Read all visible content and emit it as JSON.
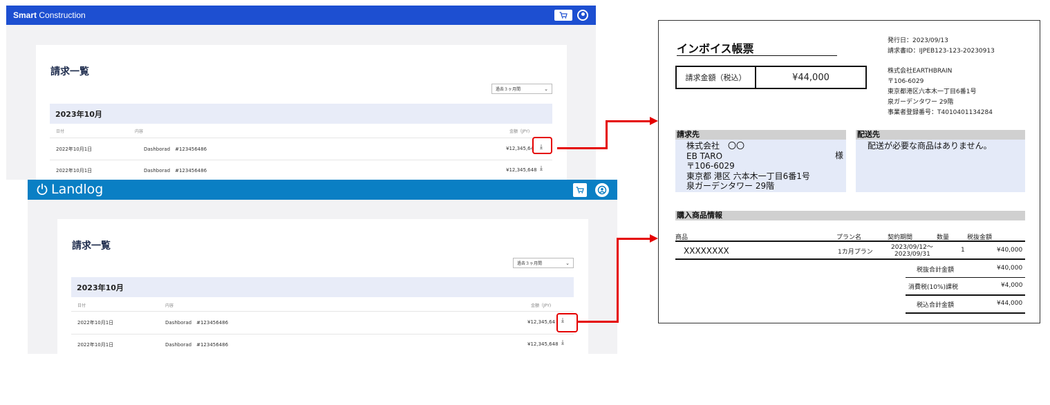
{
  "smart_construction": {
    "brand_bold": "Smart",
    "brand_rest": " Construction",
    "page_title": "請求一覧",
    "period_select": "過去３ヶ月間",
    "month_header": "2023年10月",
    "columns": {
      "date": "日付",
      "content": "内容",
      "amount": "金額（JPY)"
    },
    "rows": [
      {
        "date": "2022年10月1日",
        "content": "Dashborad　#123456486",
        "amount": "¥12,345,64"
      },
      {
        "date": "2022年10月1日",
        "content": "Dashborad　#123456486",
        "amount": "¥12,345,648"
      }
    ]
  },
  "landlog": {
    "brand": "Landlog",
    "page_title": "請求一覧",
    "period_select": "過去３ヶ月間",
    "month_header": "2023年10月",
    "columns": {
      "date": "日付",
      "content": "内容",
      "amount": "金額（JPY)"
    },
    "rows": [
      {
        "date": "2022年10月1日",
        "content": "Dashborad　#123456486",
        "amount": "¥12,345,64"
      },
      {
        "date": "2022年10月1日",
        "content": "Dashborad　#123456486",
        "amount": "¥12,345,648"
      }
    ]
  },
  "icons": {
    "cart": "cart-icon",
    "user": "user-icon",
    "download": "download-icon",
    "power": "power-icon",
    "chevron": "chevron-down-icon"
  },
  "colors": {
    "smart_header": "#1d4fd1",
    "landlog_header": "#0a7fc4",
    "highlight": "#e50000",
    "title_navy": "#1d2b4c",
    "month_header_bg": "#e8ecf8",
    "invoice_section_bg": "#e4eaf8"
  },
  "invoice": {
    "title": "インボイス帳票",
    "issue_date": "発行日：2023/09/13",
    "invoice_id": "請求書ID：IJPEB123-123-20230913",
    "amount_label": "請求金額（税込）",
    "amount_value": "¥44,000",
    "issuer": {
      "company": "株式会社EARTHBRAIN",
      "postal": "〒106-6029",
      "address1": "東京都港区六本木一丁目6番1号",
      "address2": "泉ガーデンタワー 29階",
      "registration": "事業者登録番号：T4010401134284"
    },
    "bill_to": {
      "heading": "請求先",
      "company": "株式会社　〇〇",
      "name": "EB TARO",
      "honorific": "様",
      "postal": "〒106-6029",
      "address1": "東京都 港区 六本木一丁目6番1号",
      "address2": "泉ガーデンタワー 29階"
    },
    "ship_to": {
      "heading": "配送先",
      "note": "配送が必要な商品はありません。"
    },
    "purchase": {
      "heading": "購入商品情報",
      "columns": {
        "item": "商品",
        "plan": "プラン名",
        "period": "契約期間",
        "qty": "数量",
        "price": "税抜金額"
      },
      "row": {
        "item": "XXXXXXXX",
        "plan": "1カ月プラン",
        "period_start": "2023/09/12～",
        "period_end": "2023/09/31",
        "qty": "1",
        "price": "¥40,000"
      },
      "subtotal_label": "税抜合計金額",
      "subtotal_value": "¥40,000",
      "tax_label": "消費税(10%)課税",
      "tax_value": "¥4,000",
      "total_label": "税込合計金額",
      "total_value": "¥44,000"
    }
  }
}
